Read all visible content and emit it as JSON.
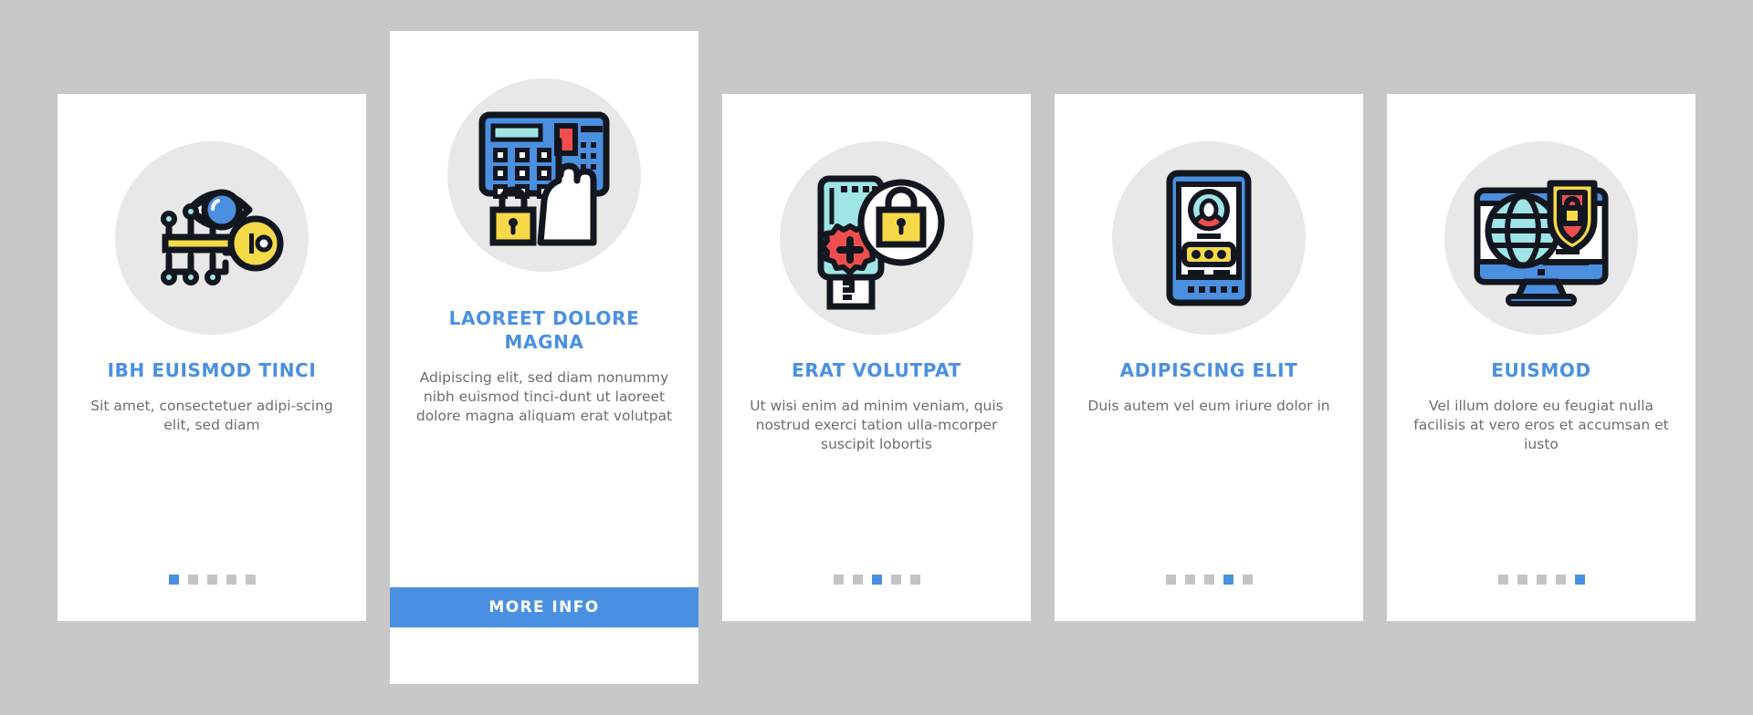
{
  "page": {
    "background_color": "#c8c8c8",
    "card_background": "#ffffff",
    "accent_color": "#4a90e2",
    "title_color": "#4a90e2",
    "body_color": "#6d6e71",
    "dot_inactive_color": "#c3c4c6",
    "icon_circle_color": "#e8e8e8"
  },
  "cards": [
    {
      "icon_name": "eye-circuit-key-icon",
      "title": "IBH EUISMOD TINCI",
      "body": "Sit amet, consectetuer adipi-scing elit, sed diam",
      "dots_total": 5,
      "dot_active_index": 0,
      "featured": false
    },
    {
      "icon_name": "keypad-hand-padlock-icon",
      "title": "LAOREET DOLORE MAGNA",
      "body": "Adipiscing elit, sed diam nonummy nibh euismod tinci-dunt ut laoreet dolore magna aliquam erat volutpat",
      "button_label": "MORE INFO",
      "featured": true
    },
    {
      "icon_name": "usb-drive-gear-padlock-icon",
      "title": "ERAT VOLUTPAT",
      "body": "Ut wisi enim ad minim veniam, quis nostrud exerci tation ulla-mcorper suscipit lobortis",
      "dots_total": 5,
      "dot_active_index": 2,
      "featured": false
    },
    {
      "icon_name": "mobile-login-password-icon",
      "title": "ADIPISCING ELIT",
      "body": "Duis autem vel eum iriure dolor in",
      "dots_total": 5,
      "dot_active_index": 3,
      "featured": false
    },
    {
      "icon_name": "desktop-globe-shield-lock-icon",
      "title": "EUISMOD",
      "body": "Vel illum dolore eu feugiat nulla facilisis at vero eros et accumsan et iusto",
      "dots_total": 5,
      "dot_active_index": 4,
      "featured": false
    }
  ]
}
